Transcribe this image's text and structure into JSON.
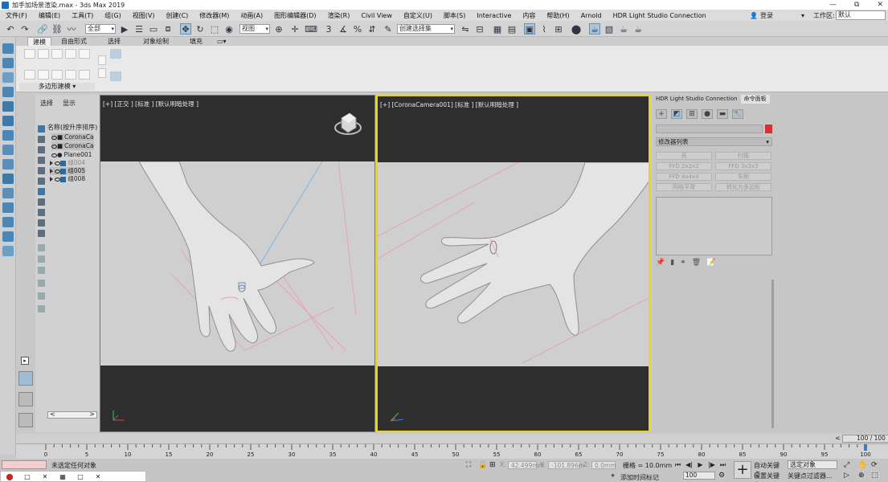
{
  "window": {
    "title": "加手加场景渲染.max - 3ds Max 2019",
    "min": "—",
    "restore": "⧉",
    "close": "✕"
  },
  "menu": [
    "文件(F)",
    "编辑(E)",
    "工具(T)",
    "组(G)",
    "视图(V)",
    "创建(C)",
    "修改器(M)",
    "动画(A)",
    "图形编辑器(D)",
    "渲染(R)",
    "Civil View",
    "自定义(U)",
    "脚本(S)",
    "Interactive",
    "内容",
    "帮助(H)",
    "Arnold",
    "HDR Light Studio Connection"
  ],
  "login": {
    "label": "登录"
  },
  "workspace": {
    "label": "工作区:",
    "value": "默认"
  },
  "toolbar": {
    "filter_value": "全部",
    "ref_coord_value": "视图",
    "selection_set_value": "创建选择集"
  },
  "ribbon": {
    "tabs": [
      "建模",
      "自由形式",
      "选择",
      "对象绘制",
      "填充"
    ],
    "group_label": "多边形建模 ▾"
  },
  "explorer": {
    "tabs": [
      "选择",
      "显示"
    ],
    "header": "名称(按升序排序)",
    "rows": [
      {
        "name": "CoronaCa",
        "kind": "camera"
      },
      {
        "name": "CoronaCa",
        "kind": "camera"
      },
      {
        "name": "Plane001",
        "kind": "object"
      },
      {
        "name": "组004",
        "kind": "group"
      },
      {
        "name": "组005",
        "kind": "group"
      },
      {
        "name": "组008",
        "kind": "group"
      }
    ]
  },
  "viewports": {
    "left_label": "[+] [正交 ] [标准 ] [默认明暗处理 ]",
    "right_label": "[+] [CoronaCamera001] [标准 ] [默认明暗处理 ]"
  },
  "command_panel": {
    "tabs": [
      "HDR Light Studio Connection",
      "命令面板"
    ],
    "modifier_list": "修改器列表",
    "buttons": [
      "壳",
      "扫描",
      "FFD 2x2x2",
      "FFD 3x3x3",
      "FFD 4x4x4",
      "车削",
      "网格平滑",
      "转化为多边形"
    ]
  },
  "timeline": {
    "frame_range": "100 / 100",
    "ticks": [
      0,
      5,
      10,
      15,
      20,
      25,
      30,
      35,
      40,
      45,
      50,
      55,
      60,
      65,
      70,
      75,
      80,
      85,
      90,
      95,
      100
    ]
  },
  "status": {
    "message": "未选定任何对象",
    "hint": "添加时间标记",
    "x_label": "X:",
    "x_value": "42.499mm",
    "y_label": "Y:",
    "y_value": "-101.896m",
    "z_label": "Z:",
    "z_value": "0.0mm",
    "grid": "栅格 = 10.0mm",
    "frame": "100",
    "auto_key": "自动关键点",
    "set_key": "设置关键点",
    "selected_object": "选定对象",
    "key_filter": "关键点过滤器..."
  },
  "colors": {
    "viewport_bg": "#2e2e2e",
    "safe_frame_bg": "#cfcfcf",
    "active_border": "#e8d90f",
    "object_color": "#d63131",
    "accent": "#a9c6de"
  }
}
